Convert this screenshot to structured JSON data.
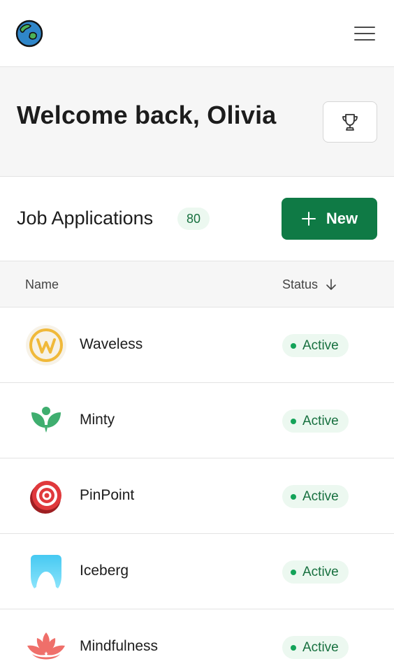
{
  "header": {
    "logo_icon": "globe-icon",
    "menu_icon": "hamburger-icon"
  },
  "hero": {
    "title": "Welcome back, Olivia",
    "trophy_icon": "trophy-icon"
  },
  "section": {
    "title": "Job Applications",
    "count": "80",
    "new_button_label": "New",
    "new_button_icon": "plus-icon"
  },
  "table": {
    "columns": {
      "name": "Name",
      "status": "Status"
    },
    "sort_icon": "arrow-down-icon",
    "rows": [
      {
        "name": "Waveless",
        "status": "Active",
        "logo": "waveless-logo"
      },
      {
        "name": "Minty",
        "status": "Active",
        "logo": "minty-logo"
      },
      {
        "name": "PinPoint",
        "status": "Active",
        "logo": "pinpoint-logo"
      },
      {
        "name": "Iceberg",
        "status": "Active",
        "logo": "iceberg-logo"
      },
      {
        "name": "Mindfulness",
        "status": "Active",
        "logo": "mindfulness-logo"
      }
    ]
  },
  "colors": {
    "accent": "#0f7a45",
    "badge_bg": "#ecf8f0",
    "badge_text": "#17703f",
    "status_dot": "#14a359"
  }
}
